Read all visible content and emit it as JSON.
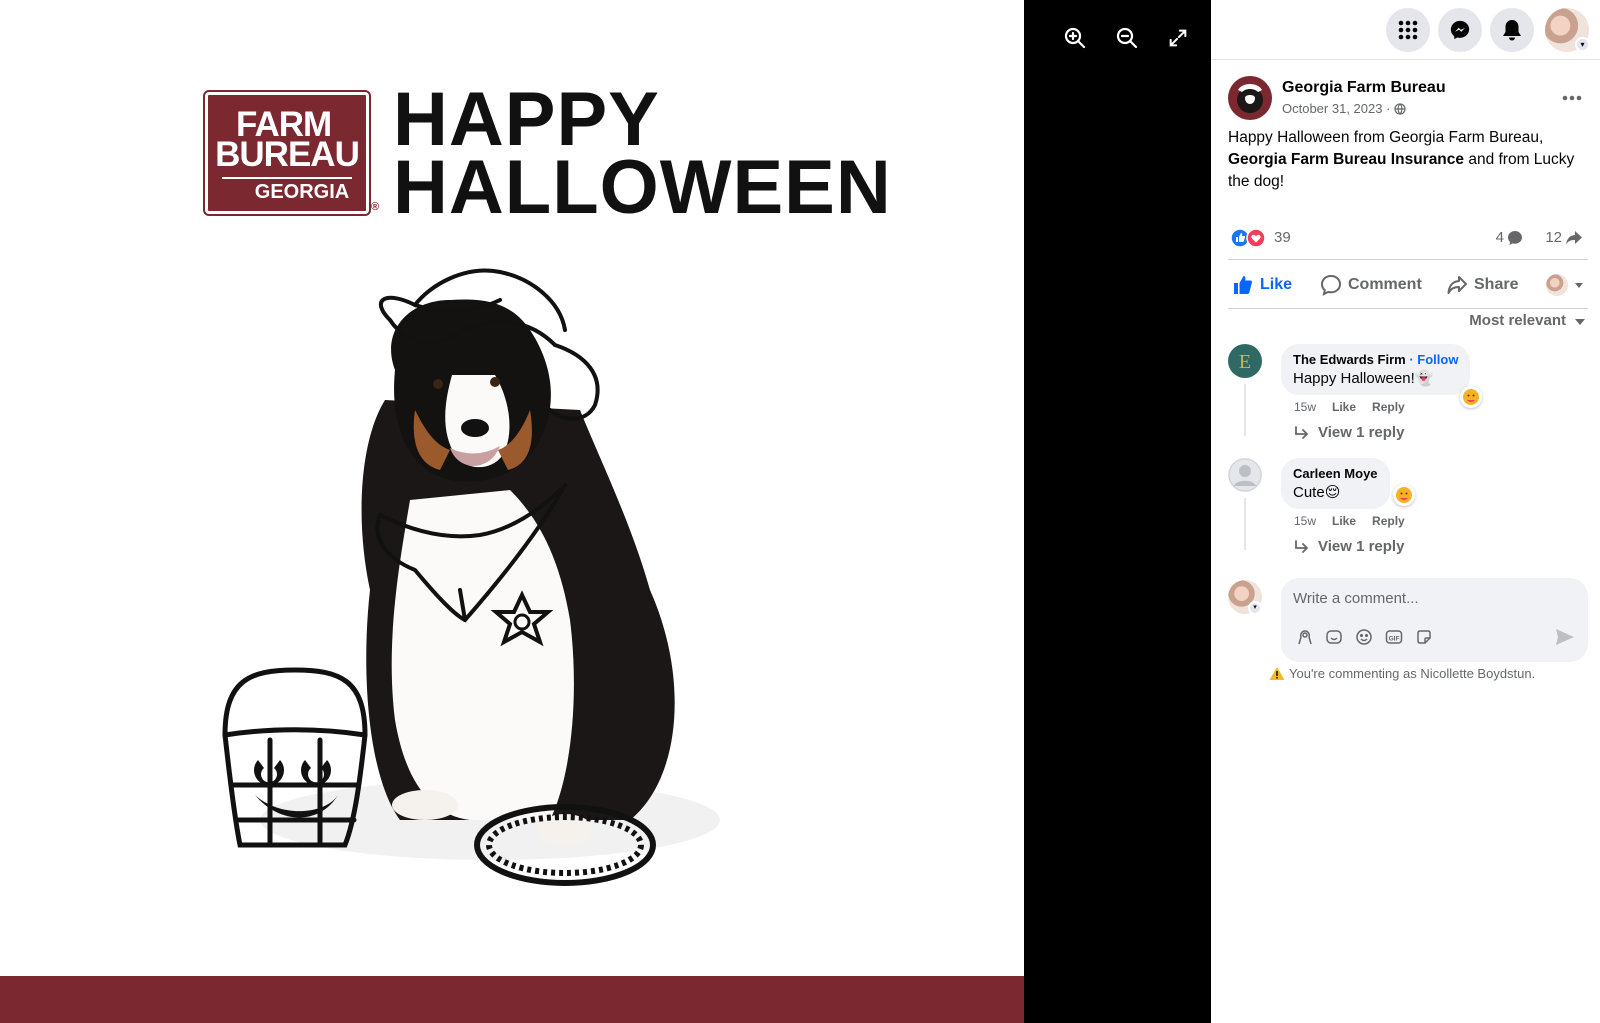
{
  "viewer": {
    "photo": {
      "logo_line1": "FARM",
      "logo_line2": "BUREAU",
      "logo_line3": "GEORGIA",
      "logo_reg": "®",
      "headline_line1": "HAPPY",
      "headline_line2": "HALLOWEEN"
    },
    "tools": [
      "zoom-in-icon",
      "zoom-out-icon",
      "fullscreen-icon"
    ]
  },
  "colors": {
    "brand": "#7b2830",
    "facebook_blue": "#0866ff",
    "muted_text": "#65676b",
    "bubble_bg": "#f0f2f5"
  },
  "post": {
    "page_name": "Georgia Farm Bureau",
    "date": "October 31, 2023 ·",
    "text_before": "Happy Halloween from Georgia Farm Bureau, ",
    "text_bold": "Georgia Farm Bureau Insurance",
    "text_after": " and from Lucky the dog!",
    "reactions_count": "39",
    "comments_count": "4",
    "shares_count": "12",
    "actions": {
      "like": "Like",
      "comment": "Comment",
      "share": "Share"
    },
    "sort_label": "Most relevant"
  },
  "comments": [
    {
      "author": "The Edwards Firm",
      "follow": "· Follow",
      "text": "Happy Halloween!",
      "emoji": "👻",
      "age": "15w",
      "like": "Like",
      "reply": "Reply",
      "view_replies": "View 1 reply"
    },
    {
      "author": "Carleen Moye",
      "text": "Cute",
      "emoji": "😌",
      "age": "15w",
      "like": "Like",
      "reply": "Reply",
      "view_replies": "View 1 reply"
    }
  ],
  "composer": {
    "placeholder": "Write a comment...",
    "warning": "You're commenting as Nicollette Boydstun."
  }
}
